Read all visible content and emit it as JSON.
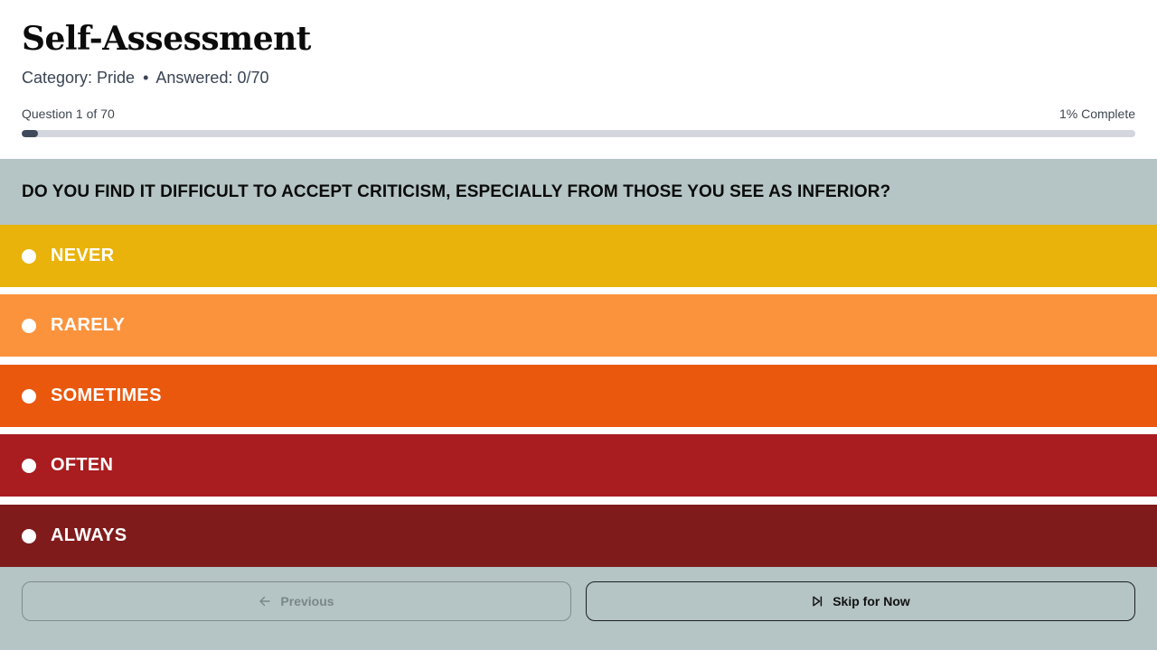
{
  "header": {
    "title": "Self-Assessment",
    "category_label": "Category: Pride",
    "separator": "•",
    "answered_label": "Answered: 0/70"
  },
  "progress": {
    "question_label": "Question 1 of 70",
    "complete_label": "1% Complete",
    "percent": 1.5
  },
  "question": {
    "text": "DO YOU FIND IT DIFFICULT TO ACCEPT CRITICISM, ESPECIALLY FROM THOSE YOU SEE AS INFERIOR?"
  },
  "options": [
    {
      "label": "NEVER",
      "color": "#e9b30b"
    },
    {
      "label": "RARELY",
      "color": "#fb933d"
    },
    {
      "label": "SOMETIMES",
      "color": "#e9580d"
    },
    {
      "label": "OFTEN",
      "color": "#a91c20"
    },
    {
      "label": "ALWAYS",
      "color": "#801b1c"
    }
  ],
  "footer": {
    "previous_label": "Previous",
    "previous_icon": "arrow-left-icon",
    "skip_label": "Skip for Now",
    "skip_icon": "skip-forward-icon"
  },
  "colors": {
    "band": "#b5c4c4",
    "progress_fill": "#3e4a5c",
    "progress_track": "#d3d6dd"
  }
}
